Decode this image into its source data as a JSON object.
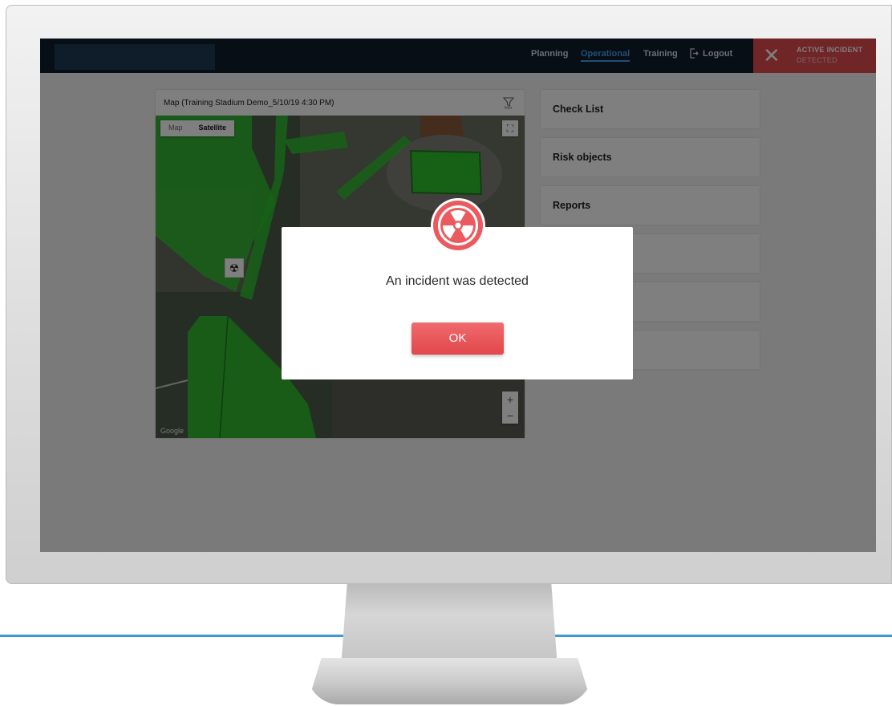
{
  "header": {
    "nav": {
      "planning": "Planning",
      "operational": "Operational",
      "training": "Training",
      "logout": "Logout"
    },
    "incident": {
      "title": "ACTIVE INCIDENT",
      "subtitle": "DETECTED"
    }
  },
  "map": {
    "title": "Map (Training Stadium Demo_5/10/19 4:30 PM)",
    "filter_label": "filter",
    "map_type_options": [
      "Map",
      "Satellite"
    ],
    "selected_map_type": "Satellite",
    "zoom_in": "+",
    "zoom_out": "−",
    "attribution": "Google"
  },
  "side_list": [
    "Check List",
    "Risk objects",
    "Reports",
    "",
    "",
    ""
  ],
  "modal": {
    "message": "An incident was detected",
    "ok_label": "OK",
    "icon": "radiation-icon"
  },
  "colors": {
    "header_bg": "#0f1c2c",
    "nav_active": "#3fa0e6",
    "incident_red": "#e14a4f",
    "button_red": "#e85a5e",
    "zone_green": "#2fc22f",
    "screen_frame_blue": "#3f98d6"
  },
  "icons": [
    "logout-icon",
    "filter-icon",
    "close-x-icon",
    "radiation-icon",
    "hazard-marker-icon",
    "fullscreen-icon"
  ]
}
